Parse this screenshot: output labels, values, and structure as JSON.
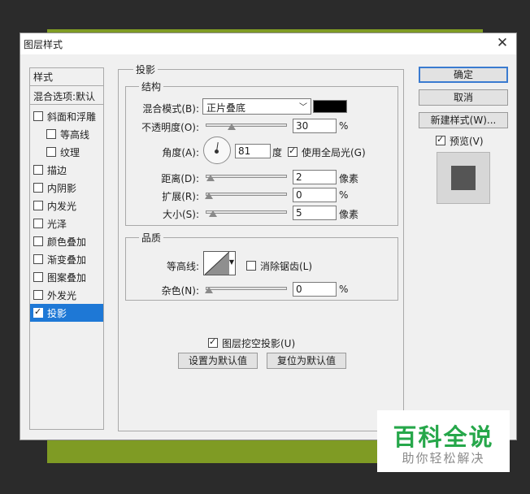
{
  "dialog": {
    "title": "图层样式",
    "close_glyph": "✕"
  },
  "style_list": {
    "header": "样式",
    "blend_options": "混合选项:默认",
    "items": [
      {
        "label": "斜面和浮雕",
        "checked": false,
        "sub": false
      },
      {
        "label": "等高线",
        "checked": false,
        "sub": true
      },
      {
        "label": "纹理",
        "checked": false,
        "sub": true
      },
      {
        "label": "描边",
        "checked": false,
        "sub": false
      },
      {
        "label": "内阴影",
        "checked": false,
        "sub": false
      },
      {
        "label": "内发光",
        "checked": false,
        "sub": false
      },
      {
        "label": "光泽",
        "checked": false,
        "sub": false
      },
      {
        "label": "颜色叠加",
        "checked": false,
        "sub": false
      },
      {
        "label": "渐变叠加",
        "checked": false,
        "sub": false
      },
      {
        "label": "图案叠加",
        "checked": false,
        "sub": false
      },
      {
        "label": "外发光",
        "checked": false,
        "sub": false
      },
      {
        "label": "投影",
        "checked": true,
        "sub": false,
        "selected": true
      }
    ]
  },
  "shadow": {
    "section_title": "投影",
    "structure": {
      "title": "结构",
      "blend_mode_label": "混合模式(B):",
      "blend_mode_value": "正片叠底",
      "shadow_color": "#000000",
      "opacity_label": "不透明度(O):",
      "opacity_value": "30",
      "opacity_unit": "%",
      "opacity_level": 0.3,
      "angle_label": "角度(A):",
      "angle_value": "81",
      "angle_unit": "度",
      "global_light_label": "使用全局光(G)",
      "global_light_checked": true,
      "distance_label": "距离(D):",
      "distance_value": "2",
      "distance_unit": "像素",
      "distance_level": 0.02,
      "spread_label": "扩展(R):",
      "spread_value": "0",
      "spread_unit": "%",
      "spread_level": 0.0,
      "size_label": "大小(S):",
      "size_value": "5",
      "size_unit": "像素",
      "size_level": 0.05
    },
    "quality": {
      "title": "品质",
      "contour_label": "等高线:",
      "antialias_label": "消除锯齿(L)",
      "antialias_checked": false,
      "noise_label": "杂色(N):",
      "noise_value": "0",
      "noise_unit": "%",
      "noise_level": 0.0
    },
    "knockout_label": "图层挖空投影(U)",
    "knockout_checked": true,
    "make_default": "设置为默认值",
    "reset_default": "复位为默认值"
  },
  "actions": {
    "ok": "确定",
    "cancel": "取消",
    "new_style": "新建样式(W)...",
    "preview_label": "预览(V)",
    "preview_checked": true
  },
  "watermark": {
    "main": "百科全说",
    "sub": "助你轻松解决"
  }
}
